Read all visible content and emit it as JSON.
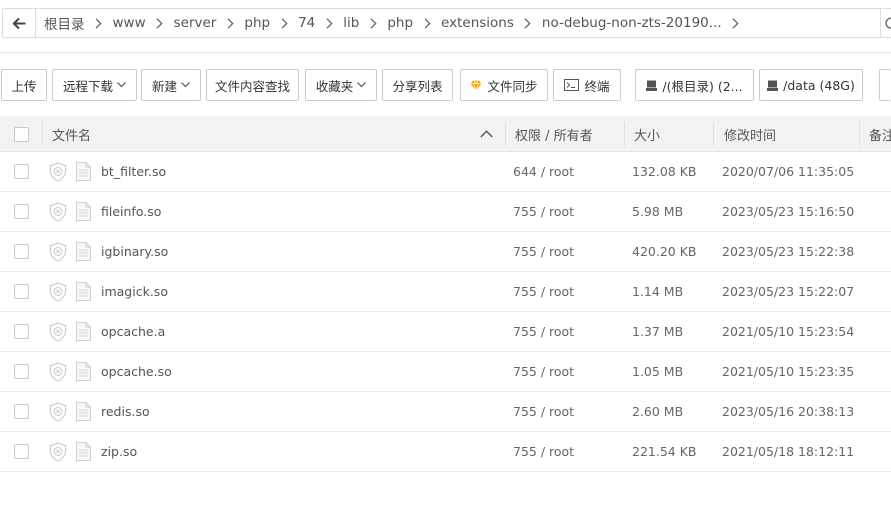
{
  "breadcrumb": {
    "items": [
      "根目录",
      "www",
      "server",
      "php",
      "74",
      "lib",
      "php",
      "extensions",
      "no-debug-non-zts-20190..."
    ]
  },
  "toolbar": {
    "upload": "上传",
    "remote_download": "远程下载",
    "new": "新建",
    "search_content": "文件内容查找",
    "favorites": "收藏夹",
    "share_list": "分享列表",
    "file_sync": "文件同步",
    "terminal": "终端",
    "disk_root": "/(根目录) (2...",
    "disk_data": "/data (48G)"
  },
  "table": {
    "headers": {
      "name": "文件名",
      "permission": "权限 / 所有者",
      "size": "大小",
      "mtime": "修改时间",
      "remark": "备注"
    },
    "rows": [
      {
        "name": "bt_filter.so",
        "perm": "644 / root",
        "size": "132.08 KB",
        "mtime": "2020/07/06 11:35:05"
      },
      {
        "name": "fileinfo.so",
        "perm": "755 / root",
        "size": "5.98 MB",
        "mtime": "2023/05/23 15:16:50"
      },
      {
        "name": "igbinary.so",
        "perm": "755 / root",
        "size": "420.20 KB",
        "mtime": "2023/05/23 15:22:38"
      },
      {
        "name": "imagick.so",
        "perm": "755 / root",
        "size": "1.14 MB",
        "mtime": "2023/05/23 15:22:07"
      },
      {
        "name": "opcache.a",
        "perm": "755 / root",
        "size": "1.37 MB",
        "mtime": "2021/05/10 15:23:54"
      },
      {
        "name": "opcache.so",
        "perm": "755 / root",
        "size": "1.05 MB",
        "mtime": "2021/05/10 15:23:35"
      },
      {
        "name": "redis.so",
        "perm": "755 / root",
        "size": "2.60 MB",
        "mtime": "2023/05/16 20:38:13"
      },
      {
        "name": "zip.so",
        "perm": "755 / root",
        "size": "221.54 KB",
        "mtime": "2021/05/18 18:12:11"
      }
    ]
  },
  "colors": {
    "accent": "#f0a30a",
    "header_bg": "#f2f2f2",
    "border": "#cccccc"
  }
}
